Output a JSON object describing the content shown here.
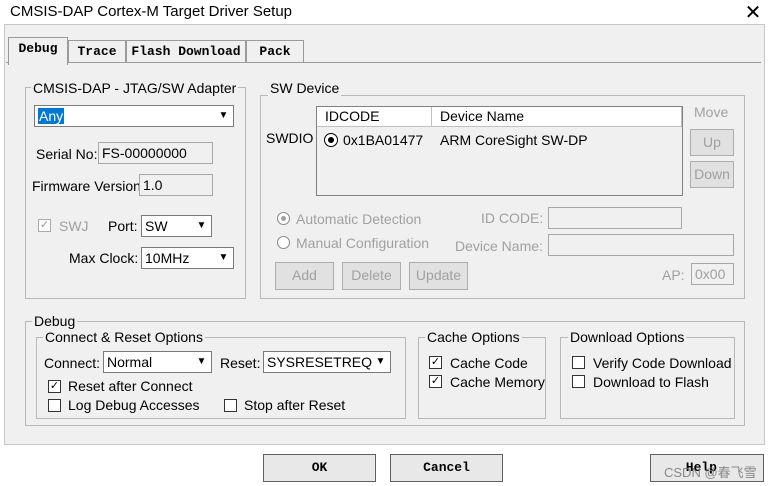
{
  "window": {
    "title": "CMSIS-DAP Cortex-M Target Driver Setup",
    "close_glyph": "✕"
  },
  "tabs": [
    "Debug",
    "Trace",
    "Flash Download",
    "Pack"
  ],
  "adapter": {
    "group_label": "CMSIS-DAP - JTAG/SW Adapter",
    "selected": "Any",
    "serial_label": "Serial No:",
    "serial_value": "FS-00000000",
    "firmware_label": "Firmware Version:",
    "firmware_value": "1.0",
    "swj_label": "SWJ",
    "port_label": "Port:",
    "port_value": "SW",
    "maxclock_label": "Max Clock:",
    "maxclock_value": "10MHz"
  },
  "sw_device": {
    "group_label": "SW Device",
    "row_label": "SWDIO",
    "col_idcode": "IDCODE",
    "col_device_name": "Device Name",
    "rows": [
      {
        "idcode": "0x1BA01477",
        "name": "ARM CoreSight SW-DP"
      }
    ],
    "move_label": "Move",
    "up_label": "Up",
    "down_label": "Down",
    "auto_detect_label": "Automatic Detection",
    "manual_config_label": "Manual Configuration",
    "idcode_label": "ID CODE:",
    "device_name_label": "Device Name:",
    "add_label": "Add",
    "delete_label": "Delete",
    "update_label": "Update",
    "ap_label": "AP:",
    "ap_value": "0x00"
  },
  "debug": {
    "group_label": "Debug",
    "connect_reset_label": "Connect & Reset Options",
    "connect_label": "Connect:",
    "connect_value": "Normal",
    "reset_label": "Reset:",
    "reset_value": "SYSRESETREQ",
    "reset_after_connect": "Reset after Connect",
    "log_debug_accesses": "Log Debug Accesses",
    "stop_after_reset": "Stop after Reset",
    "cache_options_label": "Cache Options",
    "cache_code": "Cache Code",
    "cache_memory": "Cache Memory",
    "download_options_label": "Download Options",
    "verify_code_download": "Verify Code Download",
    "download_to_flash": "Download to Flash"
  },
  "buttons": {
    "ok": "OK",
    "cancel": "Cancel",
    "help": "Help"
  },
  "watermark": "CSDN @春飞雪"
}
